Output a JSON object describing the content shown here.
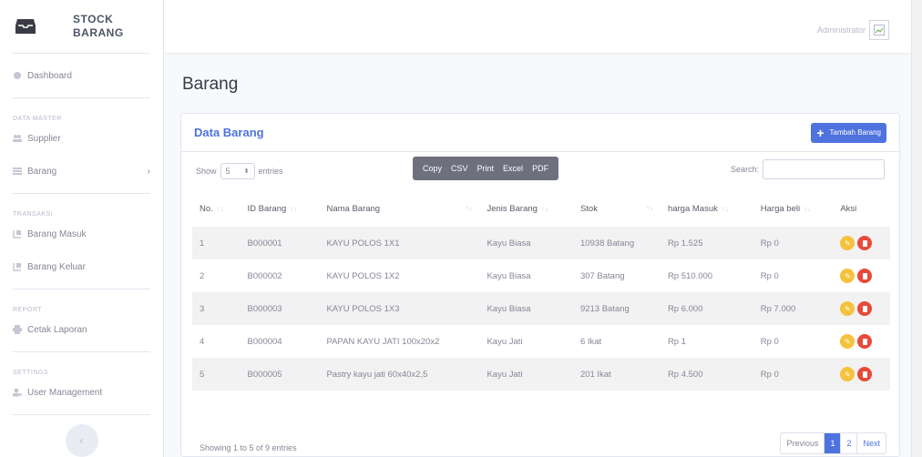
{
  "brand": {
    "line1": "STOCK",
    "line2": "BARANG",
    "logo_icon": "inbox-icon"
  },
  "sidebar": {
    "dashboard": "Dashboard",
    "heading_master": "DATA MASTER",
    "supplier": "Supplier",
    "barang": "Barang",
    "heading_transaksi": "TRANSAKSI",
    "barang_masuk": "Barang Masuk",
    "barang_keluar": "Barang Keluar",
    "heading_report": "REPORT",
    "cetak_laporan": "Cetak Laporan",
    "heading_settings": "SETTINGS",
    "user_management": "User Management",
    "toggle_glyph": "‹"
  },
  "topbar": {
    "user_name": "Administrator"
  },
  "page": {
    "title": "Barang"
  },
  "card": {
    "title": "Data Barang",
    "add_button": "Tambah Barang"
  },
  "controls": {
    "show_label": "Show",
    "entries_value": "5",
    "entries_label": "entries",
    "export": [
      "Copy",
      "CSV",
      "Print",
      "Excel",
      "PDF"
    ],
    "search_label": "Search:"
  },
  "table": {
    "headers": [
      "No.",
      "ID Barang",
      "Nama Barang",
      "Jenis Barang",
      "Stok",
      "harga Masuk",
      "Harga beli",
      "Aksi"
    ],
    "rows": [
      [
        "1",
        "B000001",
        "KAYU POLOS 1X1",
        "Kayu Biasa",
        "10938 Batang",
        "Rp 1.525",
        "Rp 0"
      ],
      [
        "2",
        "B000002",
        "KAYU POLOS 1X2",
        "Kayu Biasa",
        "307 Batang",
        "Rp 510.000",
        "Rp 0"
      ],
      [
        "3",
        "B000003",
        "KAYU POLOS 1X3",
        "Kayu Biasa",
        "9213 Batang",
        "Rp 6.000",
        "Rp 7.000"
      ],
      [
        "4",
        "B000004",
        "PAPAN KAYU JATI 100x20x2",
        "Kayu Jati",
        "6 Ikat",
        "Rp 1",
        "Rp 0"
      ],
      [
        "5",
        "B000005",
        "Pastry kayu jati 60x40x2,5",
        "Kayu Jati",
        "201 Ikat",
        "Rp 4.500",
        "Rp 0"
      ]
    ]
  },
  "footer": {
    "info": "Showing 1 to 5 of 9 entries",
    "previous": "Previous",
    "page1": "1",
    "page2": "2",
    "next": "Next"
  },
  "colors": {
    "primary": "#4e73df",
    "warning": "#f6c23e",
    "danger": "#e74a3b"
  }
}
